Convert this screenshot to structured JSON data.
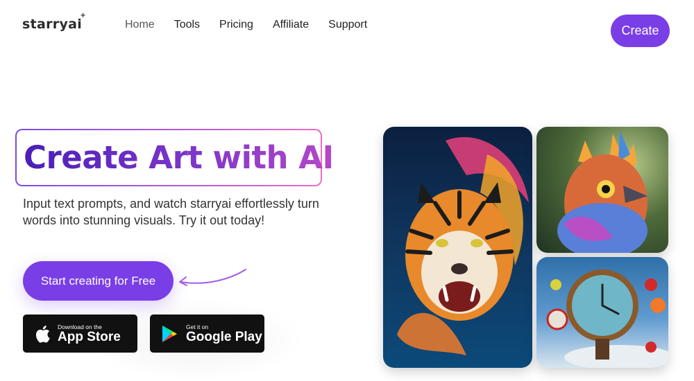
{
  "brand": {
    "logo_text": "starryai",
    "spark": "+"
  },
  "nav": {
    "items": [
      "Home",
      "Tools",
      "Pricing",
      "Affiliate",
      "Support"
    ]
  },
  "header": {
    "create_label": "Create"
  },
  "hero": {
    "title": "Create Art with AI",
    "subtitle": "Input text prompts, and watch starryai effortlessly turn words into stunning visuals. Try it out today!",
    "cta_label": "Start creating for Free"
  },
  "stores": {
    "apple": {
      "small": "Download on the",
      "big": "App Store"
    },
    "google": {
      "small": "Get it on",
      "big": "Google Play"
    }
  },
  "colors": {
    "accent": "#7a3ee6",
    "title_gradient_start": "#4a1fb8",
    "title_gradient_end": "#b449c8"
  }
}
